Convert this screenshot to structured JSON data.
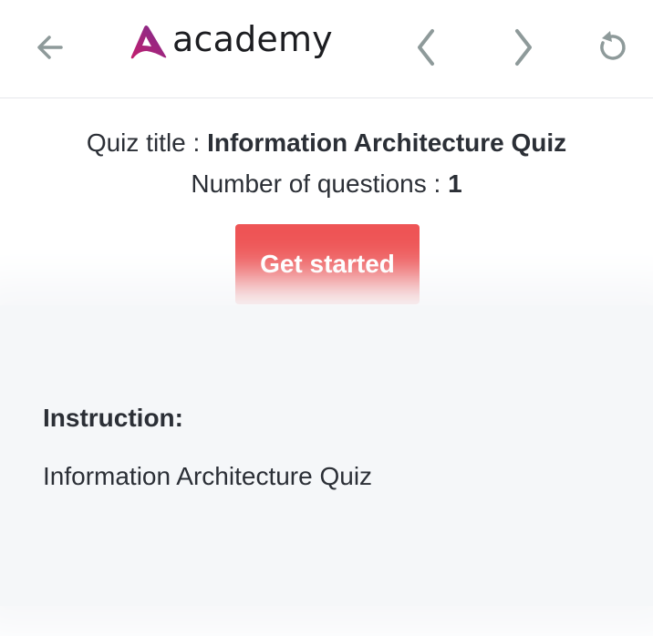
{
  "header": {
    "back_icon": "arrow-left-icon",
    "logo_text": "academy",
    "prev_icon": "chevron-left-icon",
    "next_icon": "chevron-right-icon",
    "reload_icon": "reload-icon"
  },
  "quiz": {
    "title_label": "Quiz title : ",
    "title_value": "Information Architecture Quiz",
    "questions_label": "Number of questions : ",
    "questions_value": "1",
    "start_button": "Get started"
  },
  "instruction": {
    "heading": "Instruction:",
    "body": "Information Architecture Quiz"
  },
  "colors": {
    "accent": "#ee5455",
    "icon_gray": "#8e9a9a",
    "logo_gradient_start": "#c41e6e",
    "logo_gradient_end": "#7b2d8e",
    "text": "#2b2f36",
    "panel_bg": "#f5f7f9"
  }
}
